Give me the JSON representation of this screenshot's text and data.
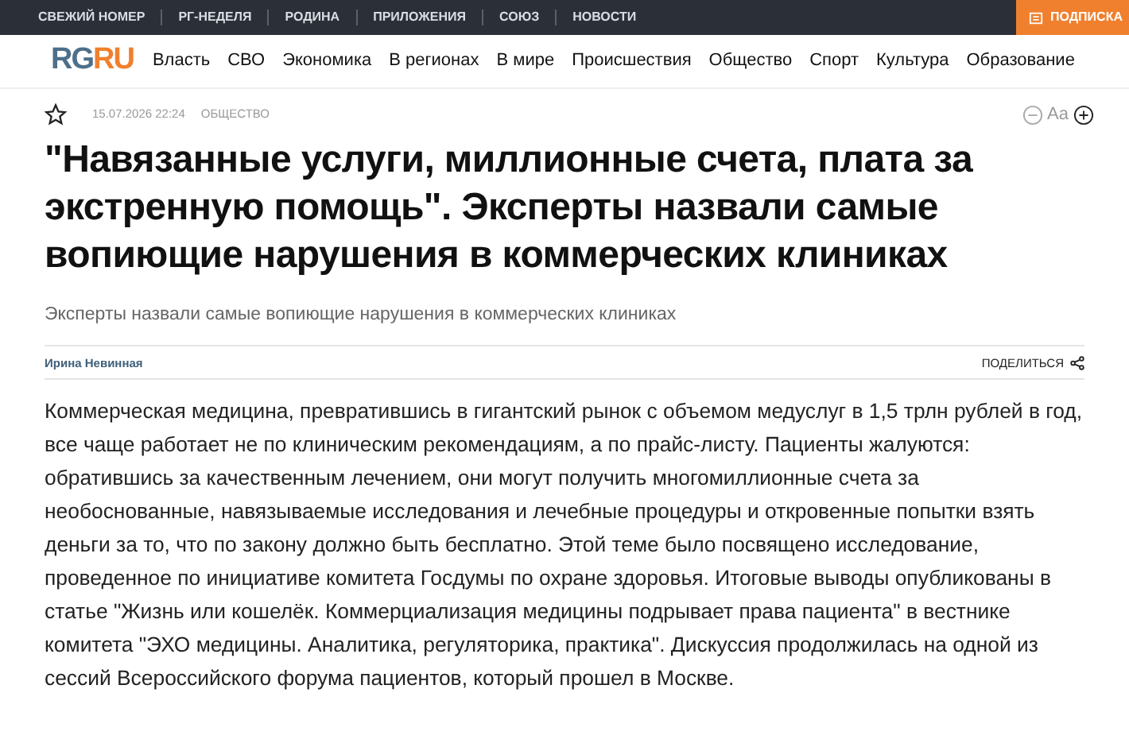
{
  "top_bar": {
    "links": [
      "СВЕЖИЙ НОМЕР",
      "РГ-НЕДЕЛЯ",
      "РОДИНА",
      "ПРИЛОЖЕНИЯ",
      "СОЮЗ",
      "НОВОСТИ"
    ],
    "subscribe": "ПОДПИСКА"
  },
  "nav": {
    "logo": [
      "RG",
      "RU"
    ],
    "items": [
      "Власть",
      "СВО",
      "Экономика",
      "В регионах",
      "В мире",
      "Происшествия",
      "Общество",
      "Спорт",
      "Культура",
      "Образование"
    ]
  },
  "meta": {
    "bookmarked": false,
    "date": "15.07.2026 22:24",
    "rubric": "ОБЩЕСТВО",
    "font_size_label": "Aa"
  },
  "title": "\"Навязанные услуги, миллионные счета, плата за экстренную помощь\". Эксперты назвали самые вопиющие нарушения в коммерческих клиниках",
  "subtitle": "Эксперты назвали самые вопиющие нарушения в коммерческих клиниках",
  "author": "Ирина Невинная",
  "share": "ПОДЕЛИТЬСЯ",
  "body": "Коммерческая медицина, превратившись в гигантский рынок с объемом медуслуг в 1,5 трлн рублей в год, все чаще работает не по клиническим рекомендациям, а по прайс-листу. Пациенты жалуются: обратившись за качественным лечением, они могут получить многомиллионные счета за необоснованные, навязываемые исследования и лечебные процедуры и откровенные попытки взять деньги за то, что по закону должно быть бесплатно. Этой теме было посвящено исследование, проведенное по инициативе комитета Госдумы по охране здоровья. Итоговые выводы опубликованы в статье \"Жизнь или кошелёк. Коммерциализация медицины подрывает права пациента\" в вестнике комитета \"ЭХО медицины. Аналитика, регуляторика, практика\". Дискуссия продолжилась на одной из сессий Всероссийского форума пациентов, который прошел в Москве."
}
